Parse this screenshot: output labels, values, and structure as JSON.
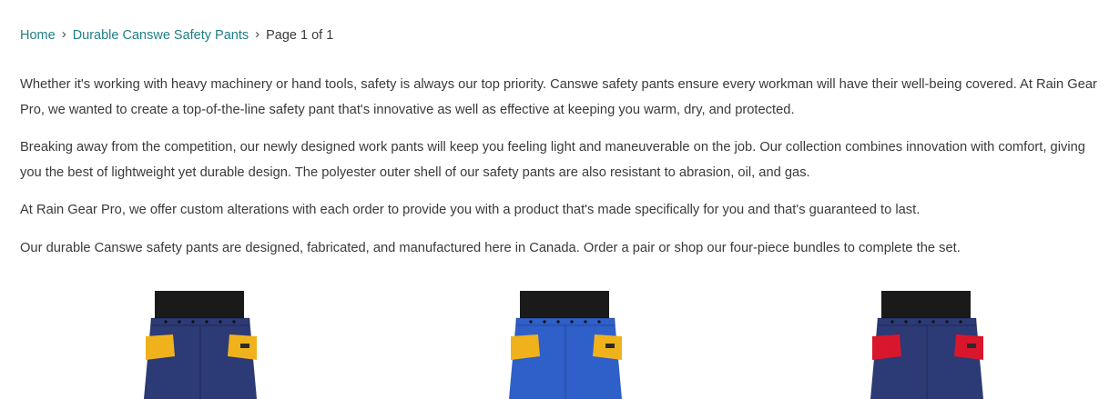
{
  "breadcrumb": {
    "home": "Home",
    "collection": "Durable Canswe Safety Pants",
    "page": "Page 1 of 1"
  },
  "description": [
    "Whether it's working with heavy machinery or hand tools, safety is always our top priority. Canswe safety pants ensure every workman will have their well-being covered. At Rain Gear Pro, we wanted to create a top-of-the-line safety pant that's innovative as well as effective at keeping you warm, dry, and protected.",
    "Breaking away from the competition, our newly designed work pants will keep you feeling light and maneuverable on the job. Our collection combines innovation with comfort, giving you the best of lightweight yet durable design. The polyester outer shell of our safety pants are also resistant to abrasion, oil, and gas.",
    "At Rain Gear Pro, we offer custom alterations with each order to provide you with a product that's made specifically for you and that's guaranteed to last.",
    "Our durable Canswe safety pants are designed, fabricated, and manufactured here in Canada. Order a pair or shop our four-piece bundles to complete the set."
  ],
  "products": [
    {
      "pants_color": "#2c3a75",
      "pocket_color": "#f0b21c"
    },
    {
      "pants_color": "#2f5fc8",
      "pocket_color": "#f0b21c"
    },
    {
      "pants_color": "#2c3a75",
      "pocket_color": "#d9172c"
    }
  ]
}
